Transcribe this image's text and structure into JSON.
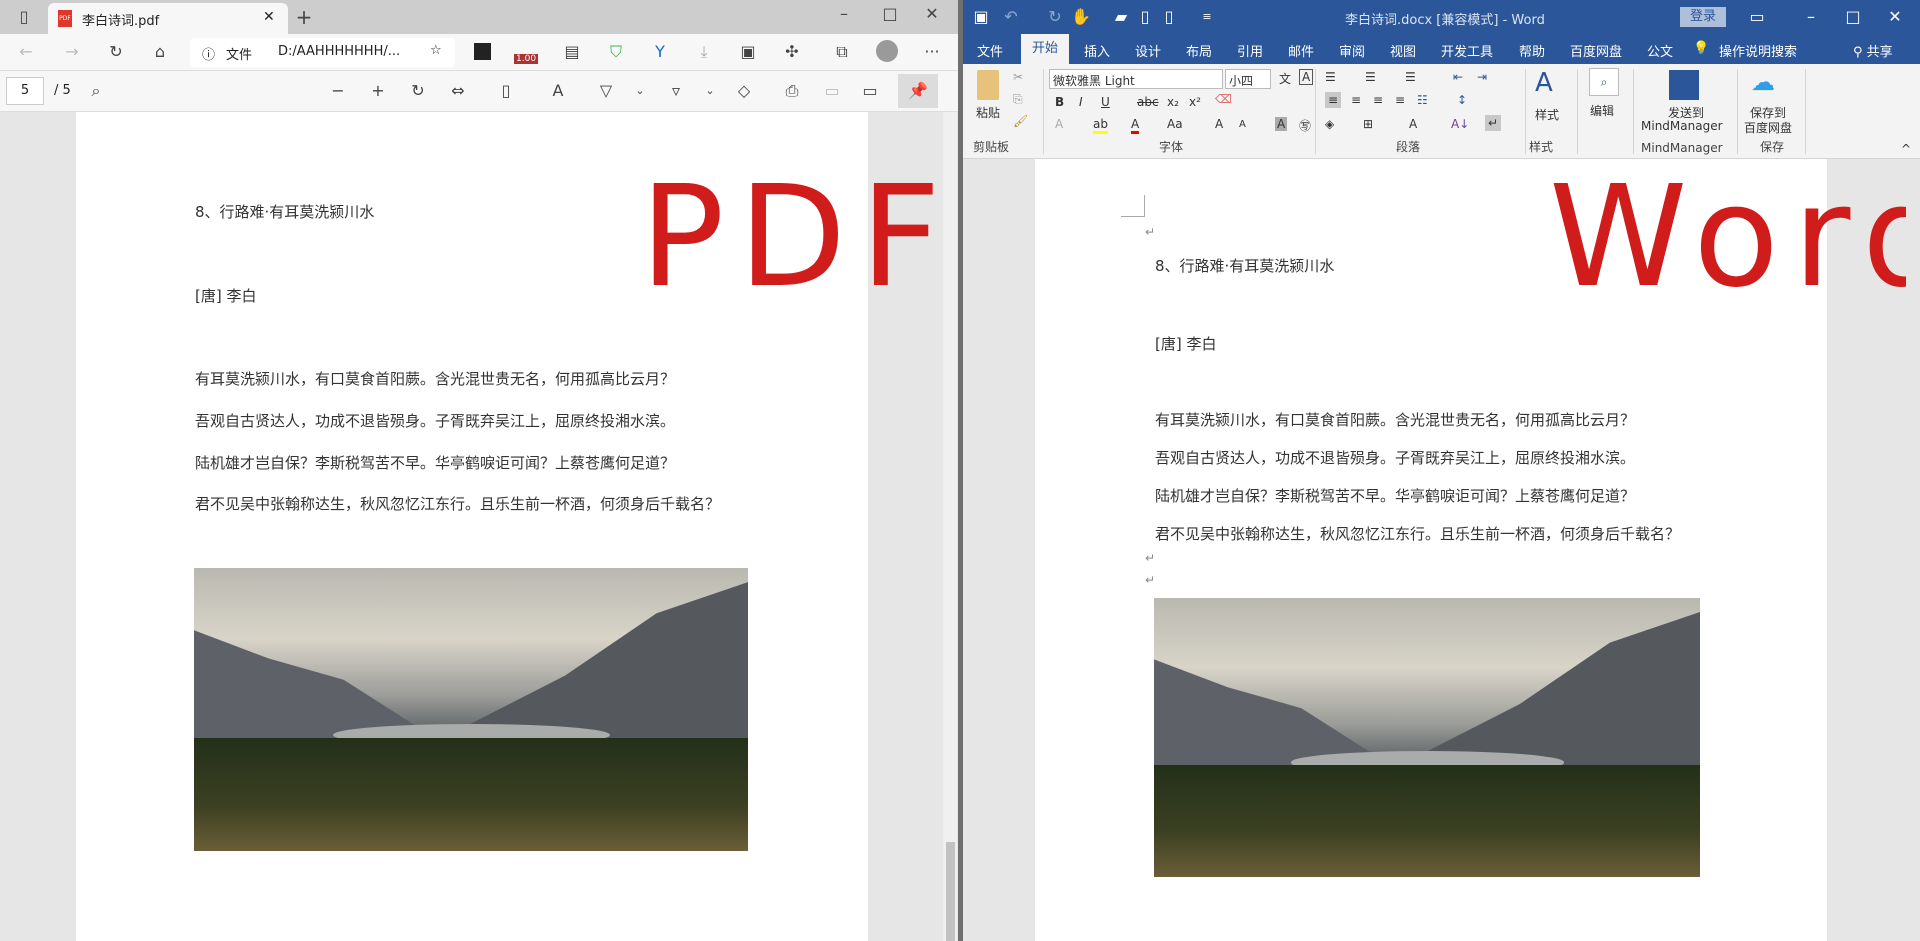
{
  "edge": {
    "tab_title": "李白诗词.pdf",
    "tab_icon": "PDF",
    "address_label": "文件",
    "address_url": "D:/AAHHHHHHH/...",
    "extension_badge": "1.00",
    "page_current": "5",
    "page_total": "/ 5",
    "big_label": "PDF"
  },
  "document": {
    "title": "8、行路难·有耳莫洗颍川水",
    "author": "[唐] 李白",
    "lines": [
      "有耳莫洗颍川水，有口莫食首阳蕨。含光混世贵无名，何用孤高比云月？",
      "吾观自古贤达人，功成不退皆殒身。子胥既弃吴江上，屈原终投湘水滨。",
      "陆机雄才岂自保？李斯税驾苦不早。华亭鹤唳讵可闻？上蔡苍鹰何足道？",
      "君不见吴中张翰称达生，秋风忽忆江东行。且乐生前一杯酒，何须身后千载名？"
    ]
  },
  "word": {
    "title": "李白诗词.docx [兼容模式]  -  Word",
    "login": "登录",
    "tabs": [
      "文件",
      "开始",
      "插入",
      "设计",
      "布局",
      "引用",
      "邮件",
      "审阅",
      "视图",
      "开发工具",
      "帮助",
      "百度网盘",
      "公文"
    ],
    "search": "操作说明搜索",
    "share": "共享",
    "font_name": "微软雅黑 Light",
    "font_size": "小四",
    "paste": "粘贴",
    "styles": "样式",
    "edit": "编辑",
    "send_mm": "发送到",
    "send_mm2": "MindManager",
    "save_baidu": "保存到",
    "save_baidu2": "百度网盘",
    "groups": [
      "剪贴板",
      "字体",
      "段落",
      "样式",
      "MindManager",
      "保存"
    ],
    "big_label": "Word",
    "para_mark": "↵"
  },
  "colors": {
    "word_blue": "#2b579a",
    "label_red": "#d11c1c"
  }
}
